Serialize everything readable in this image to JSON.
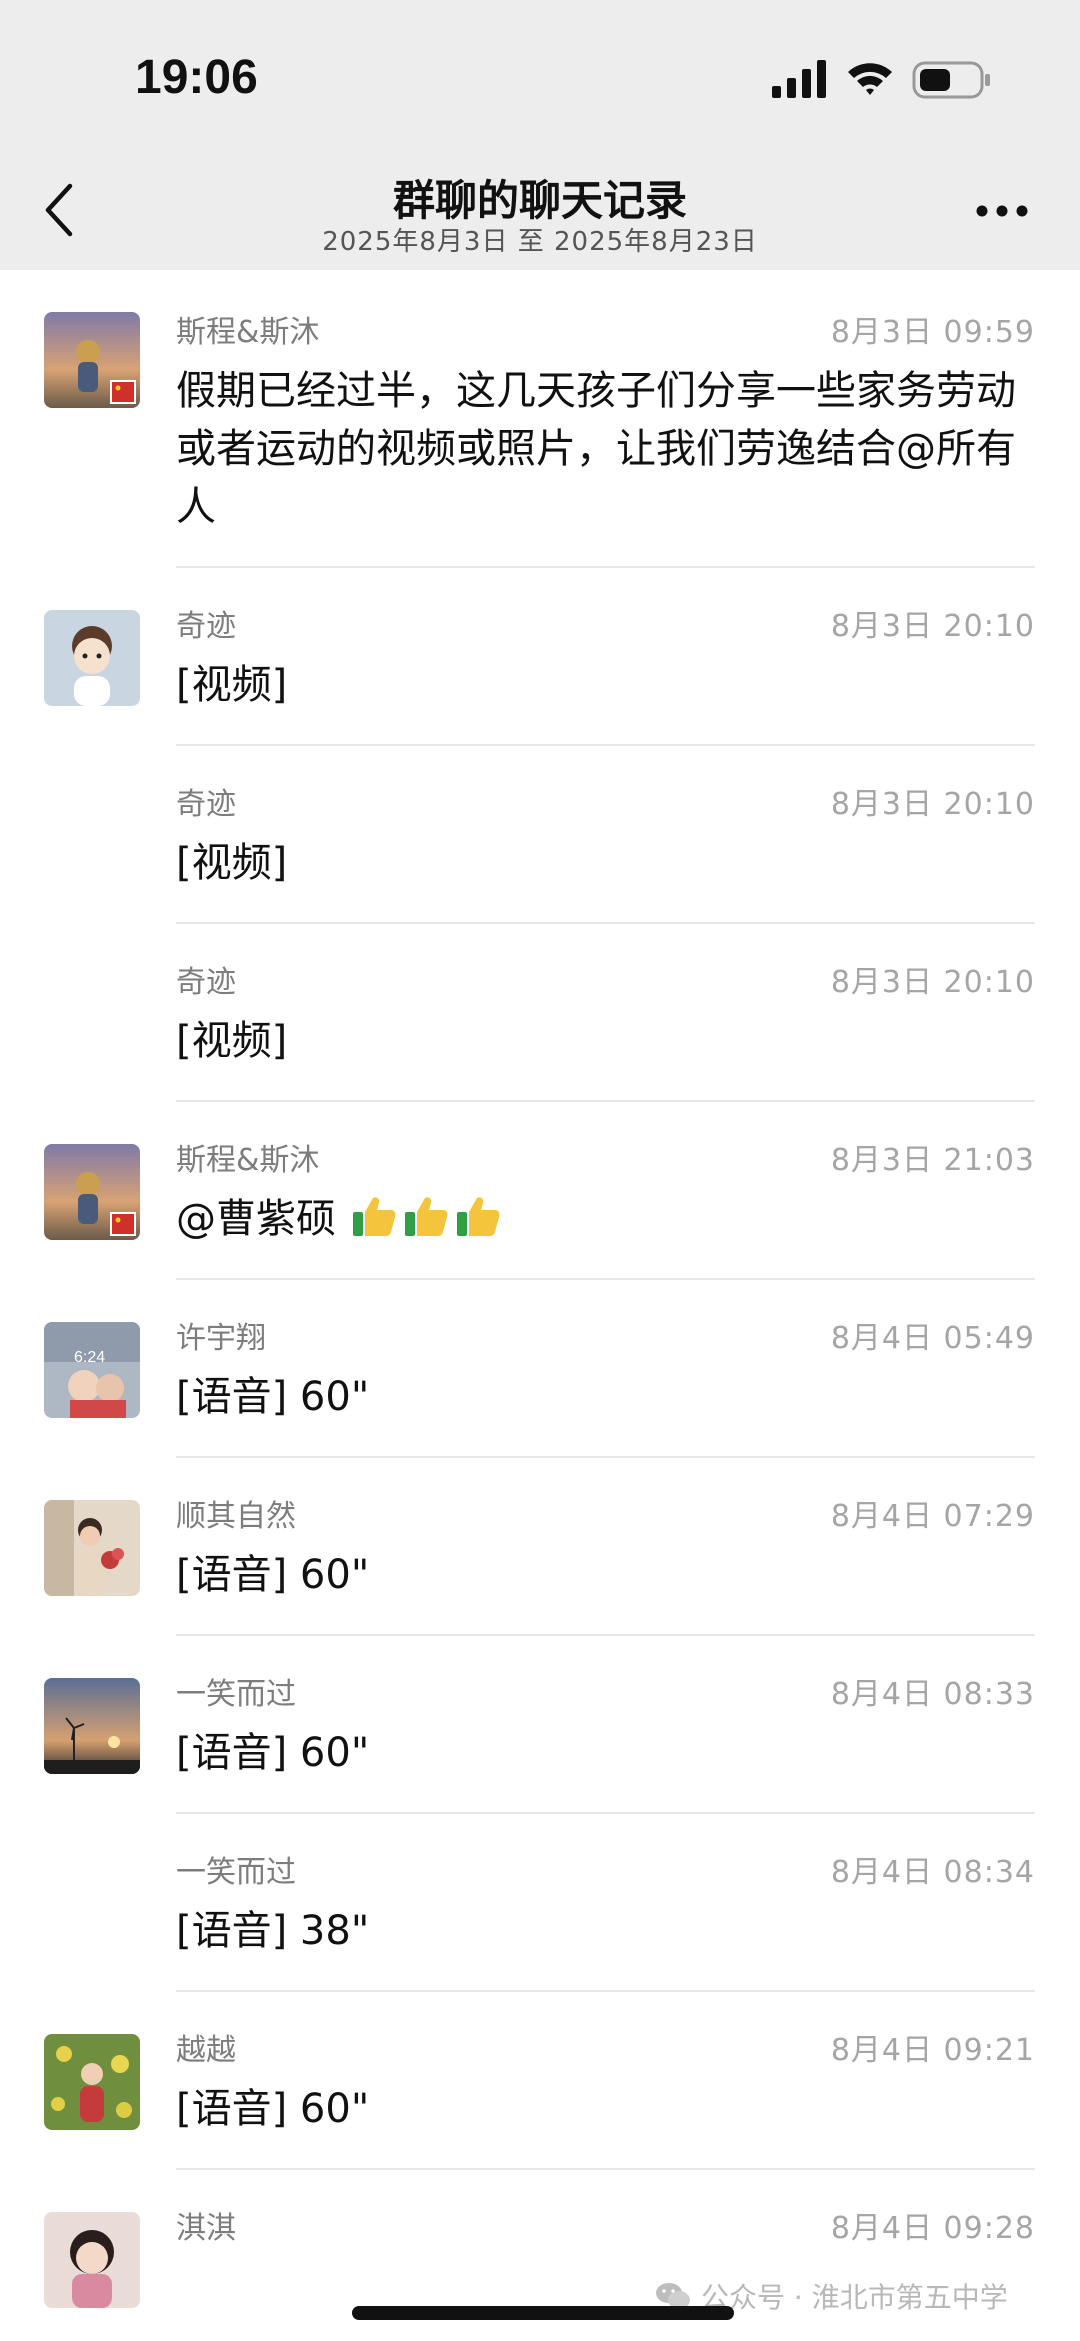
{
  "status_bar": {
    "time": "19:06"
  },
  "nav": {
    "title": "群聊的聊天记录",
    "subtitle": "2025年8月3日 至 2025年8月23日"
  },
  "messages": [
    {
      "sender": "斯程&斯沐",
      "time": "8月3日 09:59",
      "content": "假期已经过半，这几天孩子们分享一些家务劳动或者运动的视频或照片，让我们劳逸结合@所有人",
      "avatar": "sunset-kid-avatar"
    },
    {
      "sender": "奇迹",
      "time": "8月3日 20:10",
      "content": "[视频]",
      "avatar": "cartoon-girl-avatar"
    },
    {
      "sender": "奇迹",
      "time": "8月3日 20:10",
      "content": "[视频]"
    },
    {
      "sender": "奇迹",
      "time": "8月3日 20:10",
      "content": "[视频]"
    },
    {
      "sender": "斯程&斯沐",
      "time": "8月3日 21:03",
      "content": "@曹紫硕",
      "emoji": "thumbs-up-icon",
      "emoji_count": 3,
      "avatar": "sunset-kid-avatar"
    },
    {
      "sender": "许宇翔",
      "time": "8月4日 05:49",
      "content": "[语音] 60\"",
      "avatar": "child-photo-avatar"
    },
    {
      "sender": "顺其自然",
      "time": "8月4日 07:29",
      "content": "[语音] 60\"",
      "avatar": "person-flowers-avatar"
    },
    {
      "sender": "一笑而过",
      "time": "8月4日 08:33",
      "content": "[语音] 60\"",
      "avatar": "windmill-sunset-avatar"
    },
    {
      "sender": "一笑而过",
      "time": "8月4日 08:34",
      "content": "[语音] 38\""
    },
    {
      "sender": "越越",
      "time": "8月4日 09:21",
      "content": "[语音] 60\"",
      "avatar": "flower-field-avatar"
    },
    {
      "sender": "淇淇",
      "time": "8月4日 09:28",
      "avatar": "girl-avatar"
    }
  ],
  "watermark": {
    "text": "公众号 · 淮北市第五中学"
  },
  "colors": {
    "header_bg": "#ededed",
    "sender_text": "#7d7d7d",
    "time_text": "#a5a5a5",
    "divider": "#e8e8e8"
  }
}
